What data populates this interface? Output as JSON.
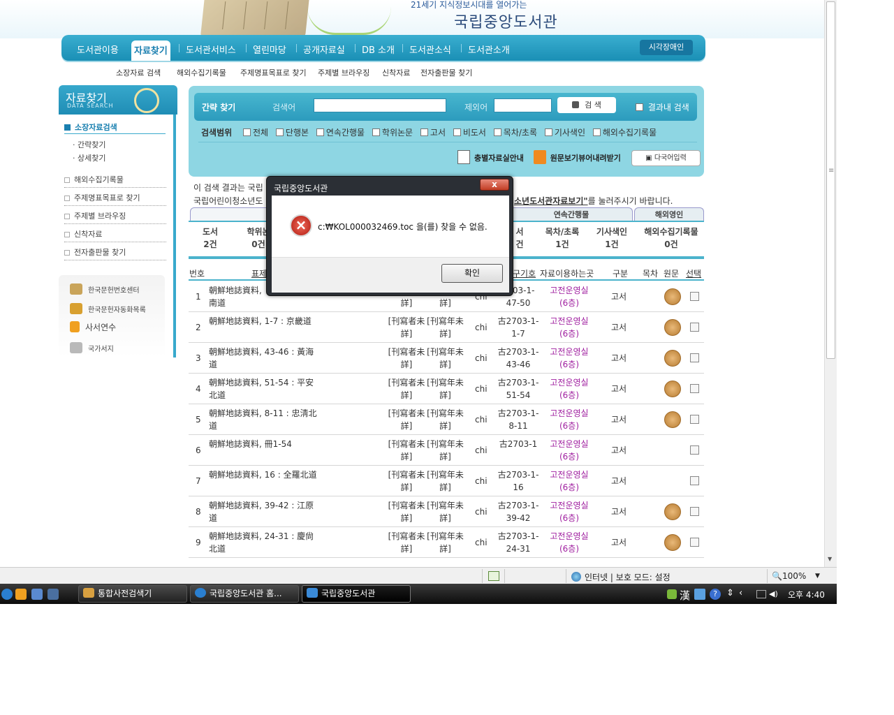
{
  "header": {
    "slogan": "21세기 지식정보시대를 열어가는",
    "title": "국립중앙도서관"
  },
  "nav": {
    "items": [
      "도서관이용",
      "자료찾기",
      "도서관서비스",
      "열린마당",
      "공개자료실",
      "DB 소개",
      "도서관소식",
      "도서관소개"
    ],
    "accessibility": "시각장애인"
  },
  "subnav": [
    "소장자료 검색",
    "해외수집기록물",
    "주제명표목표로 찾기",
    "주제별 브라우징",
    "신착자료",
    "전자출판물 찾기"
  ],
  "sidebar": {
    "title": "자료찾기",
    "title_en": "DATA SEARCH",
    "active": "소장자료검색",
    "sub_items": [
      "간략찾기",
      "상세찾기"
    ],
    "items": [
      "해외수집기록물",
      "주제명표목표로 찾기",
      "주제별 브라우징",
      "신착자료",
      "전자출판물 찾기"
    ],
    "links": [
      "한국문헌번호센터",
      "한국문헌자동화목록",
      "사서연수",
      "국가서지"
    ]
  },
  "search": {
    "label": "간략 찾기",
    "keyword_label": "검색어",
    "exclude_label": "제외어",
    "keyword_value": "",
    "exclude_value": "",
    "button": "검 색",
    "within_results": "결과내 검색",
    "scope_label": "검색범위",
    "scope_options": [
      "전체",
      "단행본",
      "연속간행물",
      "학위논문",
      "고서",
      "비도서",
      "목차/초록",
      "기사색인",
      "해외수집기록물"
    ],
    "guide_link": "충별자료실안내",
    "viewer_link": "원문보기뷰어내려받기",
    "multilang_button": "다국어입력"
  },
  "notice": {
    "line1": "이 검색 결과는 국립",
    "line2_start": "국립어린이청소년도",
    "line2_link": "소년도서관자료보기\"",
    "line2_end": "를 눌러주시기 바랍니다."
  },
  "tabs": {
    "serial": "연속간행물",
    "foreign": "해외영인"
  },
  "counts": [
    {
      "label": "도서",
      "value": "2건"
    },
    {
      "label": "학위논",
      "value": "0건"
    },
    {
      "label": "서",
      "value": "건"
    },
    {
      "label": "목차/초록",
      "value": "1건"
    },
    {
      "label": "기사색인",
      "value": "1건"
    },
    {
      "label": "해외수집기록물",
      "value": "0건"
    }
  ],
  "table": {
    "headers": {
      "no": "번호",
      "title": "표제",
      "callno_tail": "구기호",
      "location": "자료이용하는곳",
      "kind": "구분",
      "toc": "목차",
      "original": "원문",
      "select": "선택"
    },
    "rows": [
      {
        "no": "1",
        "title": "朝鮮地誌資料, ",
        "title2": "南道",
        "pub": "詳]",
        "year": "詳]",
        "lang": "chi",
        "callno": "2703-1-",
        "callno2": "47-50",
        "loc": "고전운영실",
        "loc2": "(6층)",
        "kind": "고서",
        "original": true
      },
      {
        "no": "2",
        "title": "朝鮮地誌資料, 1-7 : 京畿道",
        "title2": "",
        "pub": "[刊寫者未",
        "pub2": "詳]",
        "year": "[刊寫年未",
        "year2": "詳]",
        "lang": "chi",
        "callno": "古2703-1-",
        "callno2": "1-7",
        "loc": "고전운영실",
        "loc2": "(6층)",
        "kind": "고서",
        "original": true
      },
      {
        "no": "3",
        "title": "朝鮮地誌資料, 43-46 : 黃海",
        "title2": "道",
        "pub": "[刊寫者未",
        "pub2": "詳]",
        "year": "[刊寫年未",
        "year2": "詳]",
        "lang": "chi",
        "callno": "古2703-1-",
        "callno2": "43-46",
        "loc": "고전운영실",
        "loc2": "(6층)",
        "kind": "고서",
        "original": true
      },
      {
        "no": "4",
        "title": "朝鮮地誌資料, 51-54 : 平安",
        "title2": "北道",
        "pub": "[刊寫者未",
        "pub2": "詳]",
        "year": "[刊寫年未",
        "year2": "詳]",
        "lang": "chi",
        "callno": "古2703-1-",
        "callno2": "51-54",
        "loc": "고전운영실",
        "loc2": "(6층)",
        "kind": "고서",
        "original": true
      },
      {
        "no": "5",
        "title": "朝鮮地誌資料, 8-11 : 忠淸北",
        "title2": "道",
        "pub": "[刊寫者未",
        "pub2": "詳]",
        "year": "[刊寫年未",
        "year2": "詳]",
        "lang": "chi",
        "callno": "古2703-1-",
        "callno2": "8-11",
        "loc": "고전운영실",
        "loc2": "(6층)",
        "kind": "고서",
        "original": true
      },
      {
        "no": "6",
        "title": "朝鮮地誌資料, 冊1-54",
        "title2": "",
        "pub": "[刊寫者未",
        "pub2": "詳]",
        "year": "[刊寫年未",
        "year2": "詳]",
        "lang": "chi",
        "callno": "古2703-1",
        "callno2": "",
        "loc": "고전운영실",
        "loc2": "(6층)",
        "kind": "고서",
        "original": false
      },
      {
        "no": "7",
        "title": "朝鮮地誌資料, 16 : 全羅北道",
        "title2": "",
        "pub": "[刊寫者未",
        "pub2": "詳]",
        "year": "[刊寫年未",
        "year2": "詳]",
        "lang": "chi",
        "callno": "古2703-1-",
        "callno2": "16",
        "loc": "고전운영실",
        "loc2": "(6층)",
        "kind": "고서",
        "original": false
      },
      {
        "no": "8",
        "title": "朝鮮地誌資料, 39-42 : 江原",
        "title2": "道",
        "pub": "[刊寫者未",
        "pub2": "詳]",
        "year": "[刊寫年未",
        "year2": "詳]",
        "lang": "chi",
        "callno": "古2703-1-",
        "callno2": "39-42",
        "loc": "고전운영실",
        "loc2": "(6층)",
        "kind": "고서",
        "original": true
      },
      {
        "no": "9",
        "title": "朝鮮地誌資料, 24-31 : 慶尙",
        "title2": "北道",
        "pub": "[刊寫者未",
        "pub2": "詳]",
        "year": "[刊寫年未",
        "year2": "詳]",
        "lang": "chi",
        "callno": "古2703-1-",
        "callno2": "24-31",
        "loc": "고전운영실",
        "loc2": "(6층)",
        "kind": "고서",
        "original": true
      }
    ]
  },
  "dialog": {
    "title": "국립중앙도서관",
    "message": "c:₩KOL000032469.toc 을(를) 찾을 수 없음.",
    "ok": "확인",
    "close": "x"
  },
  "statusbar": {
    "zone": "인터넷 | 보호 모드: 설정",
    "zoom": "100%"
  },
  "taskbar": {
    "tasks": [
      "통합사전검색기",
      "국립중앙도서관 홈...",
      "국립중앙도서관"
    ],
    "ime": "漢",
    "time": "오후 4:40"
  }
}
